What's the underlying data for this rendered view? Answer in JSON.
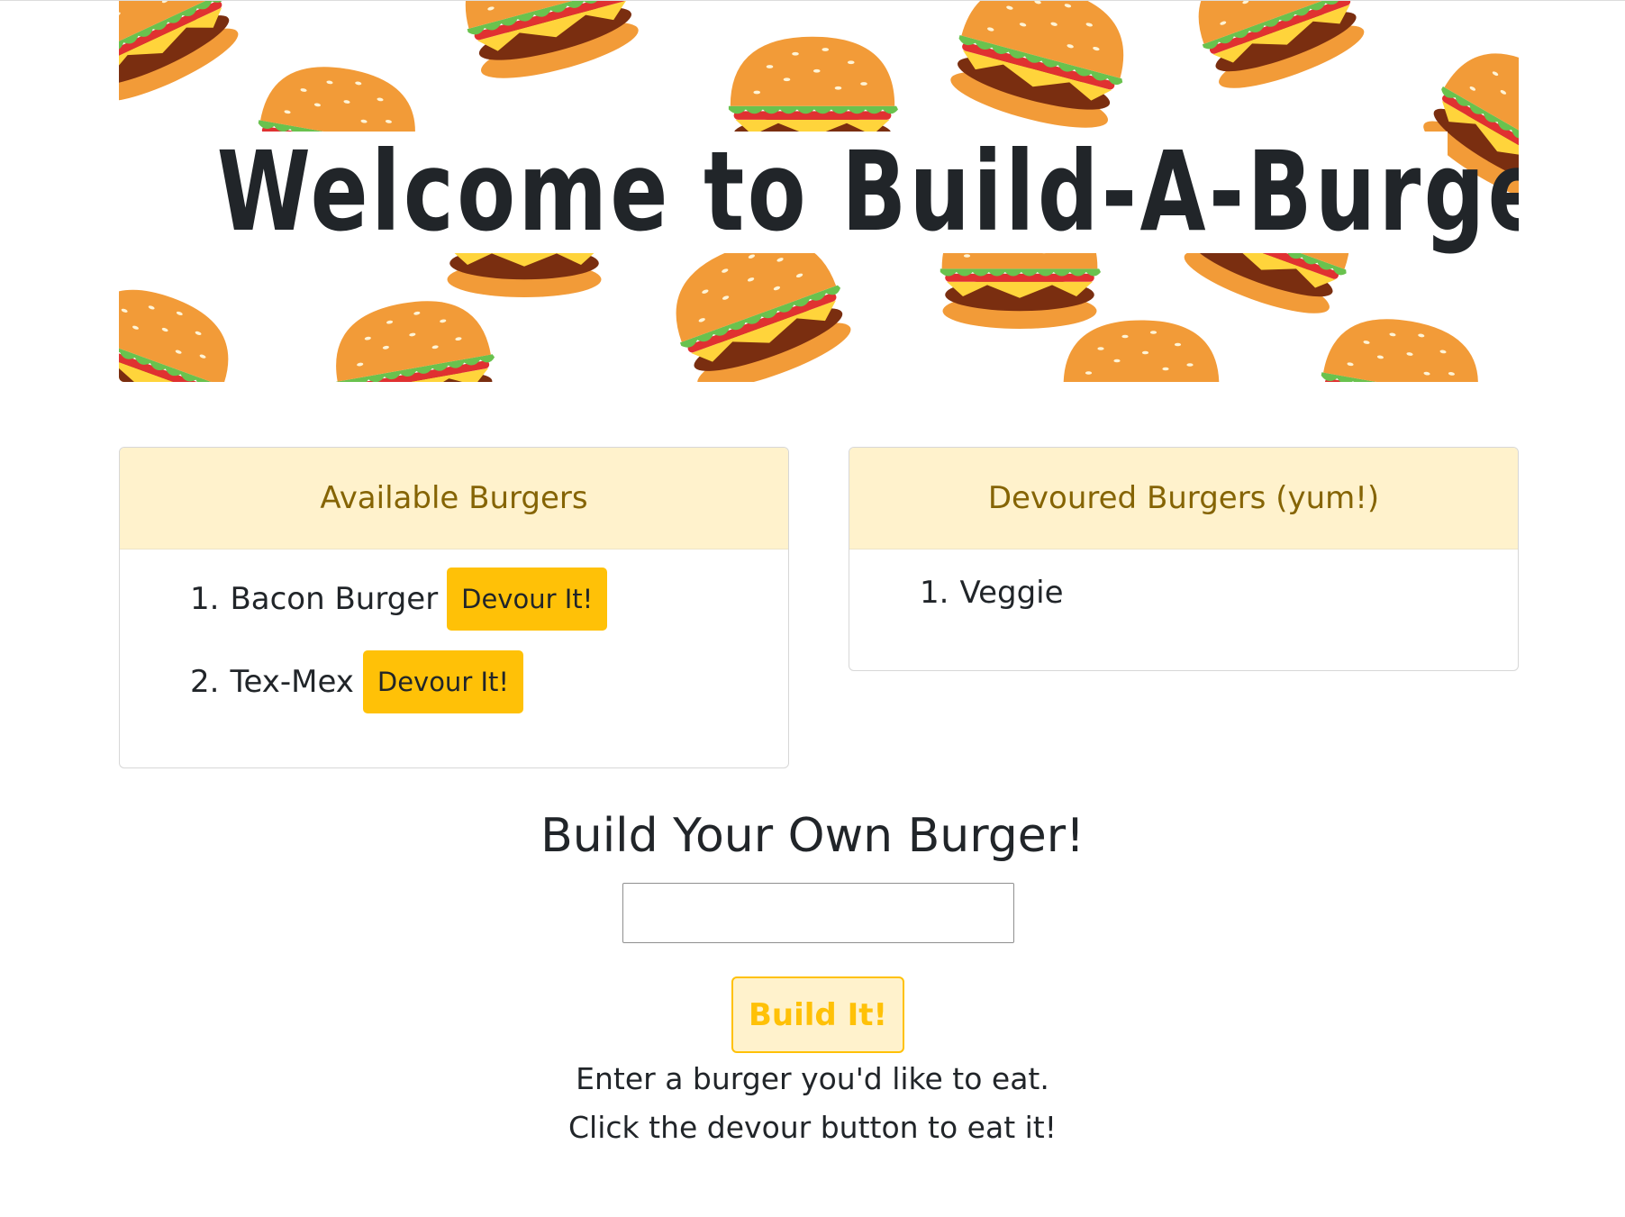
{
  "hero": {
    "title": "Welcome to Build-A-Burger!"
  },
  "available": {
    "header": "Available Burgers",
    "items": [
      {
        "number": "1.",
        "name": "Bacon Burger",
        "button_label": "Devour It!"
      },
      {
        "number": "2.",
        "name": "Tex-Mex",
        "button_label": "Devour It!"
      }
    ]
  },
  "devoured": {
    "header": "Devoured Burgers (yum!)",
    "items": [
      {
        "number": "1.",
        "name": "Veggie"
      }
    ]
  },
  "builder": {
    "heading": "Build Your Own Burger!",
    "input_value": "",
    "button_label": "Build It!",
    "help_line_1": "Enter a burger you'd like to eat.",
    "help_line_2": "Click the devour button to eat it!"
  },
  "colors": {
    "accent": "#ffc107",
    "card_header_bg": "#fff2cc",
    "card_header_text": "#856404"
  }
}
